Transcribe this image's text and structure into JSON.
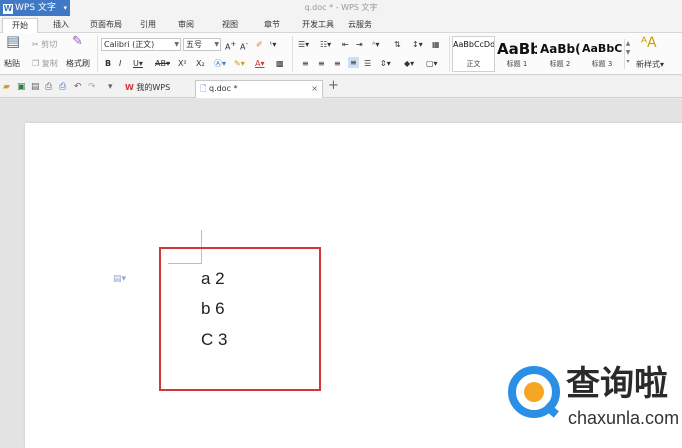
{
  "app": {
    "name": "WPS 文字",
    "logo": "W",
    "window_title": "q.doc * - WPS 文字"
  },
  "menu_tabs": [
    "开始",
    "插入",
    "页面布局",
    "引用",
    "审阅",
    "视图",
    "章节",
    "开发工具",
    "云服务"
  ],
  "active_tab": "开始",
  "ribbon": {
    "clipboard": {
      "paste": "粘贴",
      "cut": "剪切",
      "copy": "复制",
      "format_painter": "格式刷"
    },
    "font_name": "Calibri (正文)",
    "font_size": "五号",
    "styles": [
      {
        "sample": "AaBbCcDd",
        "label": "正文"
      },
      {
        "sample": "AaBb",
        "label": "标题 1"
      },
      {
        "sample": "AaBb(",
        "label": "标题 2"
      },
      {
        "sample": "AaBbC",
        "label": "标题 3"
      }
    ],
    "new_style": "新样式"
  },
  "doc_tabs": [
    {
      "label": "我的WPS",
      "icon": "wps-icon"
    },
    {
      "label": "q.doc *",
      "icon": "doc-icon",
      "active": true
    }
  ],
  "add_tab_label": "+",
  "document": {
    "lines": [
      "a 2",
      "b 6",
      "C 3"
    ]
  },
  "watermark": {
    "cn": "查询啦",
    "en": "chaxunla.com"
  },
  "colors": {
    "accent": "#3f78c5",
    "highlight_box": "#d2353a",
    "watermark_blue": "#2b8fe6",
    "watermark_orange": "#f6a623"
  }
}
